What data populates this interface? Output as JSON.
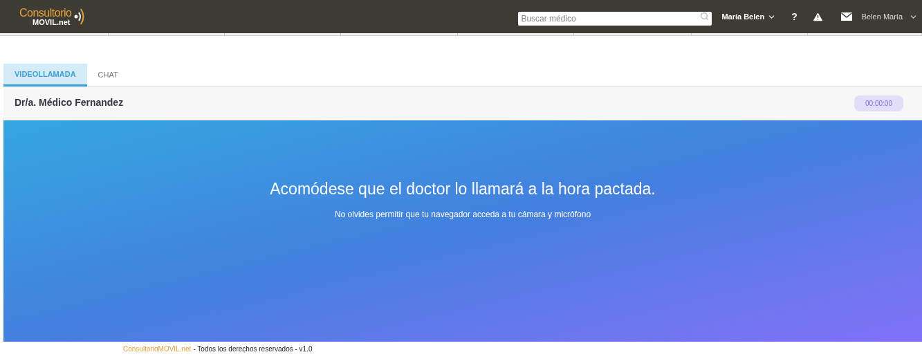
{
  "header": {
    "logo": {
      "top": "Consultorio",
      "bottom": "MOVIL.net"
    },
    "search": {
      "placeholder": "Buscar médico"
    },
    "user_menu": "María Belen",
    "help": "?",
    "account_menu": "Belen María"
  },
  "tabs": [
    {
      "label": "VIDEOLLAMADA",
      "selected": true
    },
    {
      "label": "CHAT",
      "selected": false
    }
  ],
  "call": {
    "doctor": "Dr/a. Médico Fernandez",
    "timer": "00:00:00",
    "message": "Acomódese que el doctor lo llamará a la hora pactada.",
    "hint": "No olvides permitir que tu navegador acceda a tu cámara y micrófono"
  },
  "footer": {
    "brand": "ConsultorioMOVIL.net",
    "rights": "- Todos los derechos reservados - v1.0"
  }
}
